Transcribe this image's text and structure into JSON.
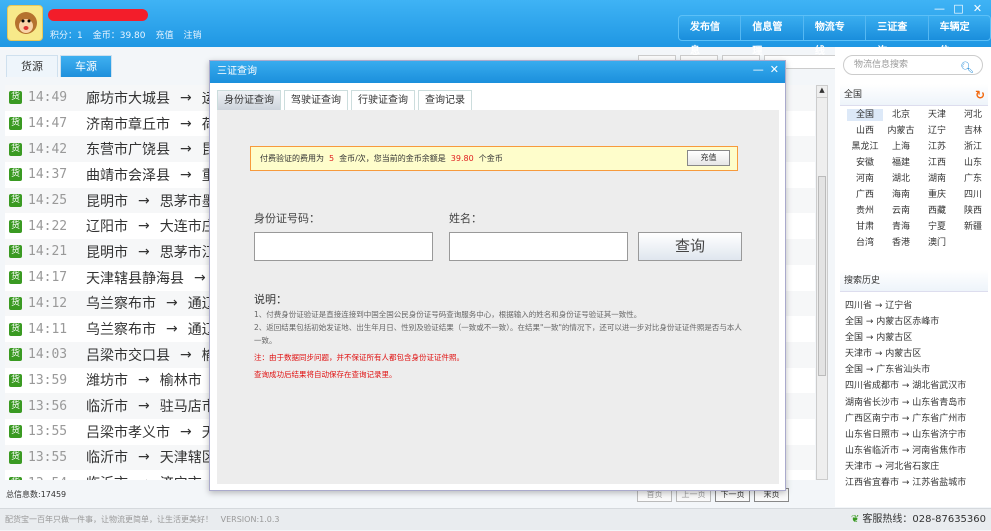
{
  "header": {
    "score_label": "积分：1",
    "coins_label": "金币：39.80",
    "recharge": "充值",
    "logout": "注销",
    "nav": [
      "发布信息",
      "信息管理",
      "物流专线",
      "三证查询",
      "车辆定位"
    ],
    "window_controls": [
      "—",
      "□",
      "✕"
    ]
  },
  "tabs": [
    "货源",
    "车源"
  ],
  "list": [
    {
      "badge": "货",
      "time": "14:49",
      "from": "廊坊市大城县",
      "to": "运"
    },
    {
      "badge": "货",
      "time": "14:47",
      "from": "济南市章丘市",
      "to": "荷"
    },
    {
      "badge": "货",
      "time": "14:42",
      "from": "东营市广饶县",
      "to": "昆"
    },
    {
      "badge": "货",
      "time": "14:37",
      "from": "曲靖市会泽县",
      "to": "重"
    },
    {
      "badge": "货",
      "time": "14:25",
      "from": "昆明市",
      "to": "思茅市墨"
    },
    {
      "badge": "货",
      "time": "14:22",
      "from": "辽阳市",
      "to": "大连市庄"
    },
    {
      "badge": "货",
      "time": "14:21",
      "from": "昆明市",
      "to": "思茅市江"
    },
    {
      "badge": "货",
      "time": "14:17",
      "from": "天津辖县静海县",
      "to": ""
    },
    {
      "badge": "货",
      "time": "14:12",
      "from": "乌兰察布市",
      "to": "通辽"
    },
    {
      "badge": "货",
      "time": "14:11",
      "from": "乌兰察布市",
      "to": "通辽"
    },
    {
      "badge": "货",
      "time": "14:03",
      "from": "吕梁市交口县",
      "to": "榆"
    },
    {
      "badge": "货",
      "time": "13:59",
      "from": "潍坊市",
      "to": "榆林市"
    },
    {
      "badge": "货",
      "time": "13:56",
      "from": "临沂市",
      "to": "驻马店市"
    },
    {
      "badge": "货",
      "time": "13:55",
      "from": "吕梁市孝义市",
      "to": "天"
    },
    {
      "badge": "货",
      "time": "13:55",
      "from": "临沂市",
      "to": "天津辖区"
    },
    {
      "badge": "货",
      "time": "13:54",
      "from": "临沂市",
      "to": "济宁市"
    }
  ],
  "arrow": "→",
  "total": "总信息数:17459",
  "pager": [
    "首页",
    "上一页",
    "下一页",
    "末页"
  ],
  "right": {
    "search_placeholder": "物流信息搜索",
    "region_title": "全国",
    "provinces": [
      "全国",
      "北京",
      "天津",
      "河北",
      "山西",
      "内蒙古",
      "辽宁",
      "吉林",
      "黑龙江",
      "上海",
      "江苏",
      "浙江",
      "安徽",
      "福建",
      "江西",
      "山东",
      "河南",
      "湖北",
      "湖南",
      "广东",
      "广西",
      "海南",
      "重庆",
      "四川",
      "贵州",
      "云南",
      "西藏",
      "陕西",
      "甘肃",
      "青海",
      "宁夏",
      "新疆",
      "台湾",
      "香港",
      "澳门"
    ],
    "selected_province": "全国",
    "history_title": "搜索历史",
    "history": [
      "四川省 → 辽宁省",
      "全国 → 内蒙古区赤峰市",
      "全国 → 内蒙古区",
      "天津市 → 内蒙古区",
      "全国 → 广东省汕头市",
      "四川省成都市 → 湖北省武汉市",
      "湖南省长沙市 → 山东省青岛市",
      "广西区南宁市 → 广东省广州市",
      "山东省日照市 → 山东省济宁市",
      "山东省临沂市 → 河南省焦作市",
      "天津市 → 河北省石家庄",
      "江西省宜春市 → 江苏省盐城市"
    ]
  },
  "dialog": {
    "title": "三证查询",
    "tabs": [
      "身份证查询",
      "驾驶证查询",
      "行驶证查询",
      "查询记录"
    ],
    "notice": {
      "p1": "付费验证的费用为",
      "fee": "5",
      "p2": "金币/次，您当前的金币余额是",
      "balance": "39.80",
      "p3": "个金币",
      "button": "充值"
    },
    "id_label": "身份证号码：",
    "id_value": "",
    "name_label": "姓名：",
    "name_value": "",
    "query": "查询",
    "desc_title": "说明：",
    "desc1": "1、付费身份证验证是直接连接到中国全国公民身份证号码查询服务中心，根据输入的姓名和身份证号验证其一致性。",
    "desc2": "2、返回结果包括初始发证地、出生年月日、性别及验证结果（一致或不一致）。在结果\"一致\"的情况下，还可以进一步对比身份证证件照是否与本人一致。",
    "note1": "注：由于数据同步问题，并不保证所有人都包含身份证证件照。",
    "note2": "查询成功后结果将自动保存在查询记录里。"
  },
  "footer": {
    "slogan": "配货宝一百年只做一件事，让物流更简单，让生活更美好！",
    "version": "VERSION:1.0.3",
    "hotline": "客服热线：028-87635360"
  },
  "colors": {
    "accent": "#1f97e3",
    "badge": "#3a9a22",
    "warning": "#e02020"
  }
}
